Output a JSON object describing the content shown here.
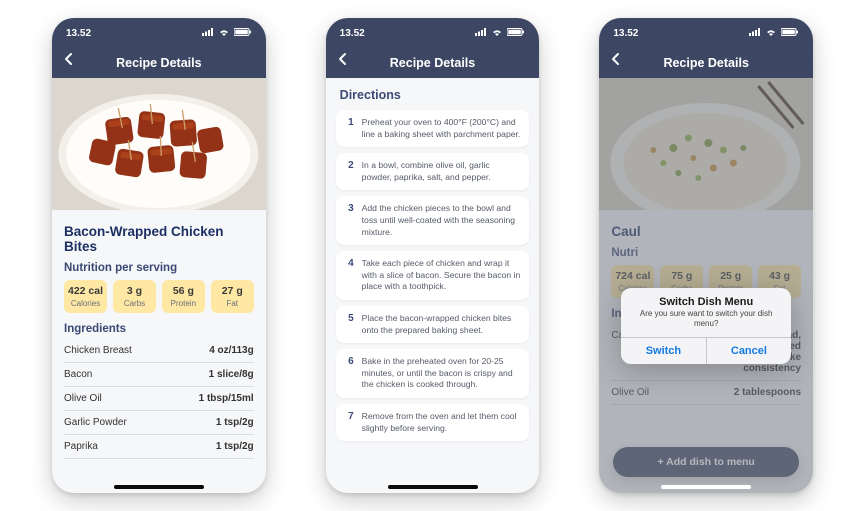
{
  "statusbar": {
    "time": "13.52"
  },
  "navbar": {
    "title": "Recipe Details"
  },
  "nutrition_heading": "Nutrition per serving",
  "ingredients_heading": "Ingredients",
  "directions_heading": "Directions",
  "nutrition_labels": {
    "calories": "Calories",
    "carbs": "Carbs",
    "protein": "Protein",
    "fat": "Fat"
  },
  "screen1": {
    "recipe_title": "Bacon-Wrapped Chicken Bites",
    "nutrition": {
      "calories": "422 cal",
      "carbs": "3 g",
      "protein": "56 g",
      "fat": "27 g"
    },
    "ingredients": [
      {
        "name": "Chicken Breast",
        "amount": "4 oz/113g"
      },
      {
        "name": "Bacon",
        "amount": "1 slice/8g"
      },
      {
        "name": "Olive Oil",
        "amount": "1 tbsp/15ml"
      },
      {
        "name": "Garlic Powder",
        "amount": "1 tsp/2g"
      },
      {
        "name": "Paprika",
        "amount": "1 tsp/2g"
      }
    ]
  },
  "screen2": {
    "steps": [
      "Preheat your oven to 400°F (200°C) and line a baking sheet with parchment paper.",
      "In a bowl, combine olive oil, garlic powder, paprika, salt, and pepper.",
      "Add the chicken pieces to the bowl and toss until well-coated with the seasoning mixture.",
      "Take each piece of chicken and wrap it with a slice of bacon. Secure the bacon in place with a toothpick.",
      "Place the bacon-wrapped chicken bites onto the prepared baking sheet.",
      "Bake in the preheated oven for 20-25 minutes, or until the bacon is crispy and the chicken is cooked through.",
      "Remove from the oven and let them cool slightly before serving."
    ]
  },
  "screen3": {
    "recipe_title_partial": "Caul",
    "nutrition_heading_partial": "Nutri",
    "nutrition": {
      "calories": "724 cal",
      "carbs": "75 g",
      "protein": "25 g",
      "fat": "43 g"
    },
    "ingredients": [
      {
        "name": "Cauliflower",
        "amount": "1 medium head, grated or processed into rice-like consistency"
      },
      {
        "name": "Olive Oil",
        "amount": "2 tablespoons"
      }
    ],
    "alert": {
      "title": "Switch Dish Menu",
      "message": "Are you sure want to switch your dish menu?",
      "primary": "Switch",
      "secondary": "Cancel"
    },
    "add_button": "+ Add dish to menu"
  }
}
